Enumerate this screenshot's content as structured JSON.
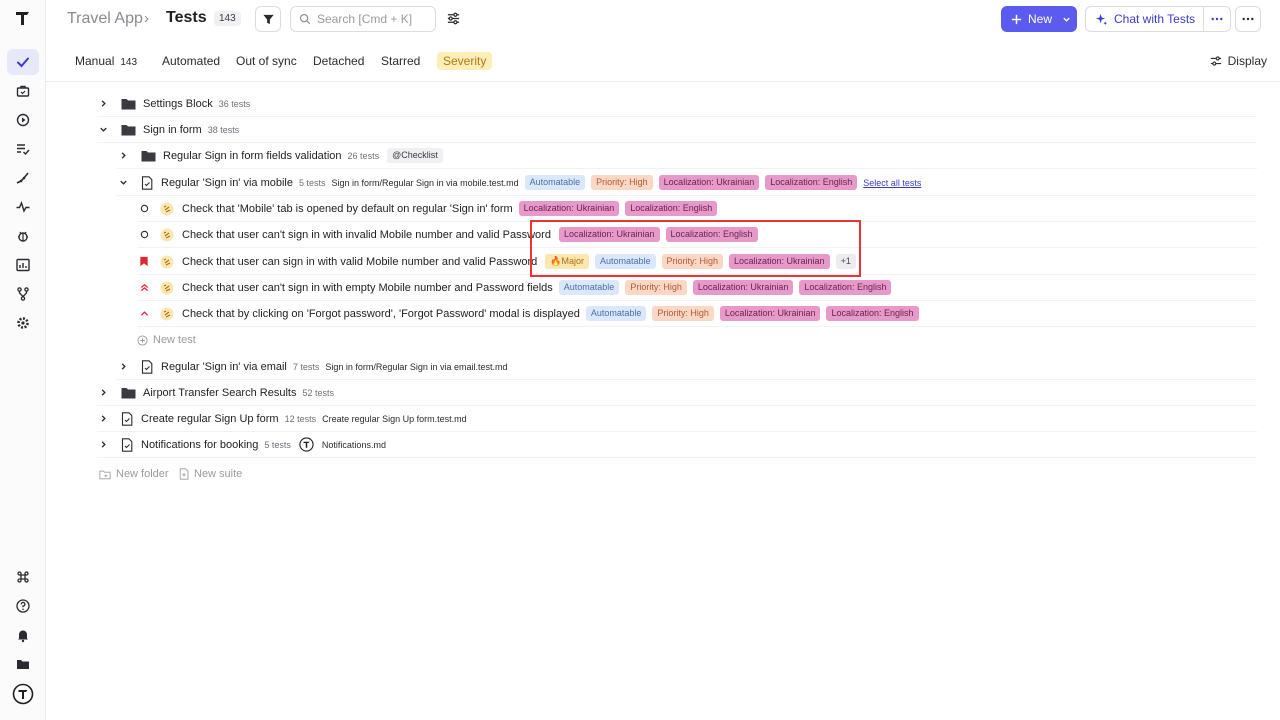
{
  "header": {
    "app_name": "Travel App",
    "separator": "›",
    "title": "Tests",
    "count": "143",
    "search_placeholder": "Search [Cmd + K]",
    "new_label": "New",
    "chat_label": "Chat with Tests",
    "accent": "#5b5bf0"
  },
  "tabs": {
    "manual": "Manual",
    "manual_count": "143",
    "automated": "Automated",
    "out_of_sync": "Out of sync",
    "detached": "Detached",
    "starred": "Starred",
    "severity": "Severity",
    "display": "Display"
  },
  "tree": {
    "settings": {
      "name": "Settings Block",
      "count": "36 tests"
    },
    "signin": {
      "name": "Sign in form",
      "count": "38 tests"
    },
    "regular_fields": {
      "name": "Regular Sign in form fields validation",
      "count": "26 tests",
      "tag": "@Checklist"
    },
    "mobile": {
      "name": "Regular 'Sign in' via mobile",
      "count": "5 tests",
      "path": "Sign in form/Regular Sign in via mobile.test.md",
      "tag_auto": "Automatable",
      "tag_pri": "Priority: High",
      "tag_uk": "Localization: Ukrainian",
      "tag_en": "Localization: English",
      "select_all": "Select all tests"
    },
    "tests": [
      {
        "title": "Check that 'Mobile' tab is opened by default on regular 'Sign in' form",
        "tag_uk": "Localization: Ukrainian",
        "tag_en": "Localization: English"
      },
      {
        "title": "Check that user can't sign in with invalid Mobile number and valid Password",
        "tag_uk": "Localization: Ukrainian",
        "tag_en": "Localization: English"
      },
      {
        "title": "Check that user can sign in with valid Mobile number and valid Password",
        "tag_major": "🔥Major",
        "tag_auto": "Automatable",
        "tag_pri": "Priority: High",
        "tag_uk": "Localization: Ukrainian",
        "more": "+1"
      },
      {
        "title": "Check that user can't sign in with empty Mobile number and Password fields",
        "tag_auto": "Automatable",
        "tag_pri": "Priority: High",
        "tag_uk": "Localization: Ukrainian",
        "tag_en": "Localization: English"
      },
      {
        "title": "Check that by clicking on 'Forgot password', 'Forgot Password' modal is displayed",
        "tag_auto": "Automatable",
        "tag_pri": "Priority: High",
        "tag_uk": "Localization: Ukrainian",
        "tag_en": "Localization: English"
      }
    ],
    "new_test": "New test",
    "email": {
      "name": "Regular 'Sign in' via email",
      "count": "7 tests",
      "path": "Sign in form/Regular Sign in via email.test.md"
    },
    "airport": {
      "name": "Airport Transfer Search Results",
      "count": "52 tests"
    },
    "signup": {
      "name": "Create regular Sign Up form",
      "count": "12 tests",
      "path": "Create regular Sign Up form.test.md"
    },
    "notifications": {
      "name": "Notifications for booking",
      "count": "5 tests",
      "path": "Notifications.md"
    },
    "new_folder": "New folder",
    "new_suite": "New suite"
  }
}
